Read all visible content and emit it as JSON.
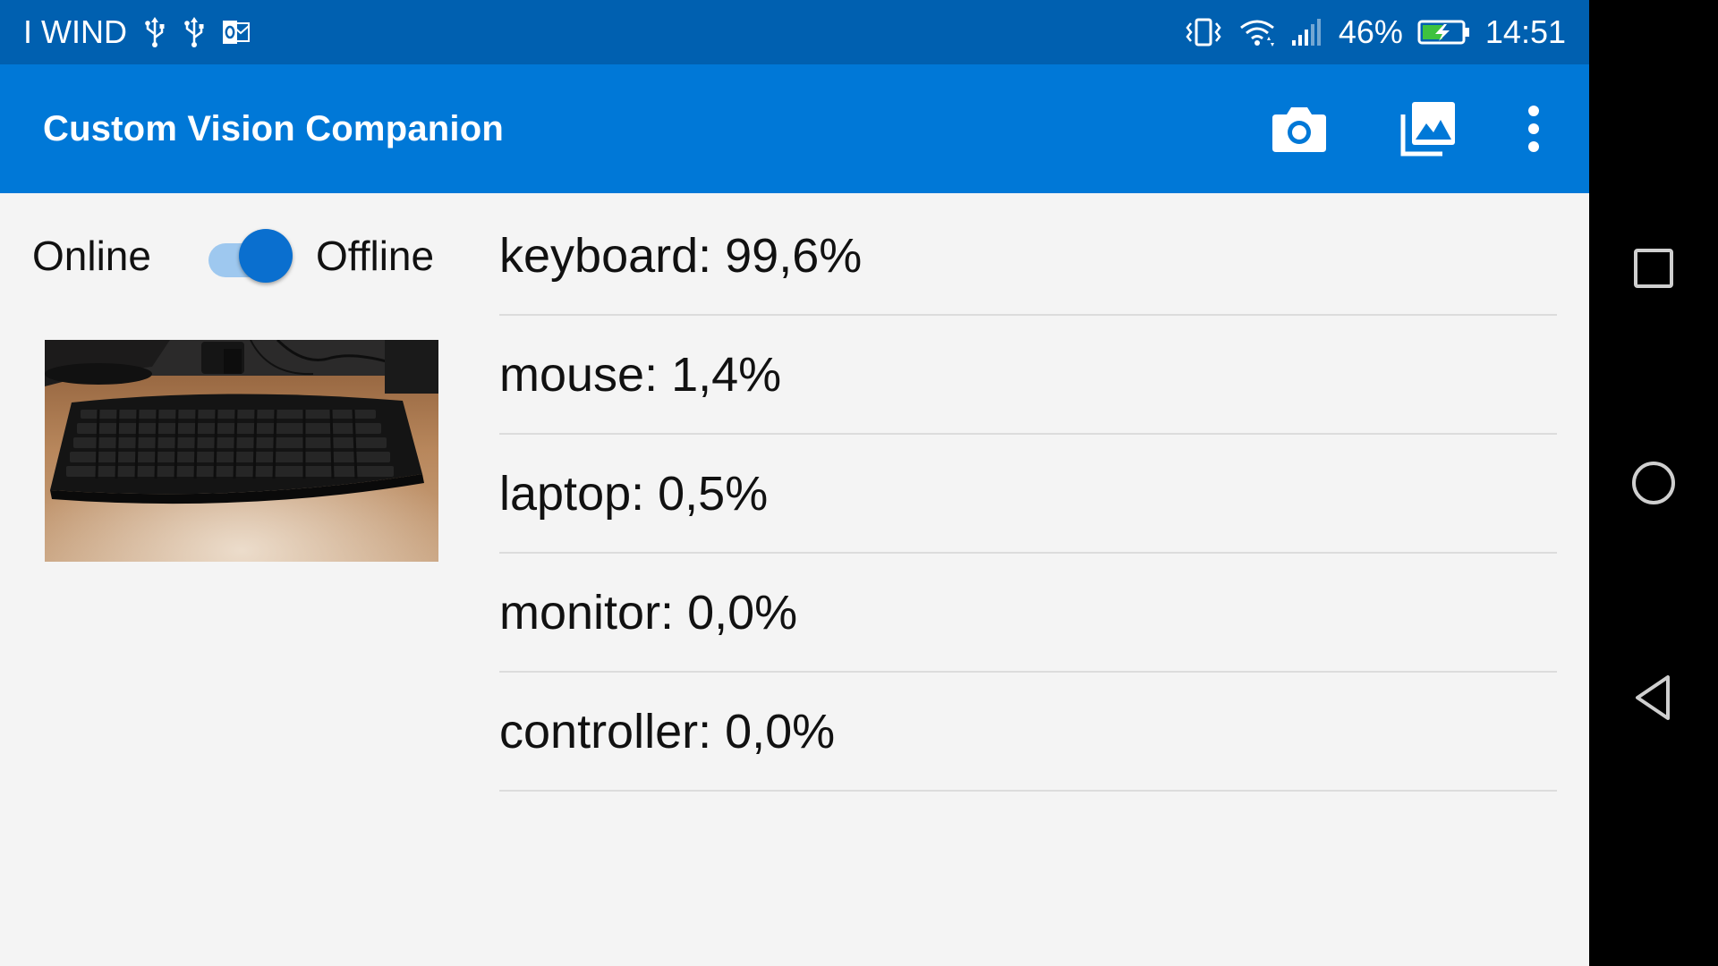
{
  "statusbar": {
    "carrier": "I WIND",
    "battery": "46%",
    "time": "14:51",
    "icons_left": [
      "usb-icon",
      "usb-icon",
      "outlook-icon"
    ],
    "icons_right": [
      "vibrate-icon",
      "wifi-icon",
      "signal-icon",
      "battery-charging-icon"
    ]
  },
  "appbar": {
    "title": "Custom Vision Companion",
    "actions": [
      "camera-icon",
      "gallery-icon",
      "more-vert-icon"
    ]
  },
  "mode": {
    "left_label": "Online",
    "right_label": "Offline",
    "state": "Offline"
  },
  "photo": {
    "subject": "keyboard"
  },
  "results": [
    {
      "text": "keyboard: 99,6%"
    },
    {
      "text": "mouse: 1,4%"
    },
    {
      "text": "laptop: 0,5%"
    },
    {
      "text": "monitor: 0,0%"
    },
    {
      "text": "controller: 0,0%"
    }
  ],
  "navbar": {
    "buttons": [
      "recents-icon",
      "home-icon",
      "back-icon"
    ]
  },
  "colors": {
    "statusbar": "#0060b0",
    "appbar": "#0078d7",
    "switch_thumb": "#0a6fcf",
    "switch_track": "#9ec8ef",
    "background": "#f4f4f4"
  }
}
